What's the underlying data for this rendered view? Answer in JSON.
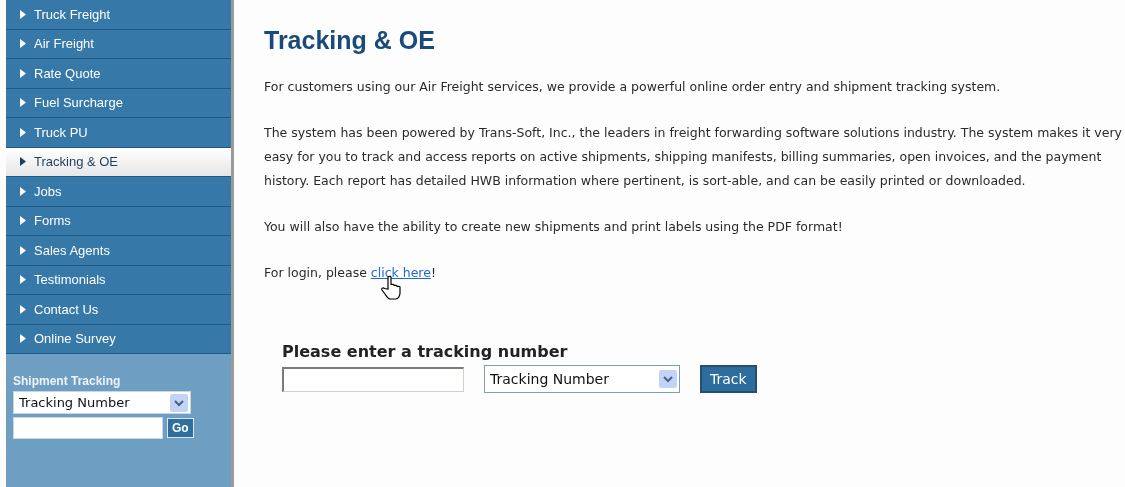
{
  "sidebar": {
    "items": [
      {
        "label": "Truck Freight",
        "selected": false
      },
      {
        "label": "Air Freight",
        "selected": false
      },
      {
        "label": "Rate Quote",
        "selected": false
      },
      {
        "label": "Fuel Surcharge",
        "selected": false
      },
      {
        "label": "Truck PU",
        "selected": false
      },
      {
        "label": "Tracking & OE",
        "selected": true
      },
      {
        "label": "Jobs",
        "selected": false
      },
      {
        "label": "Forms",
        "selected": false
      },
      {
        "label": "Sales Agents",
        "selected": false
      },
      {
        "label": "Testimonials",
        "selected": false
      },
      {
        "label": "Contact Us",
        "selected": false
      },
      {
        "label": "Online Survey",
        "selected": false
      }
    ],
    "tracking": {
      "title": "Shipment Tracking",
      "select_value": "Tracking Number",
      "button": "Go"
    }
  },
  "main": {
    "title": "Tracking & OE",
    "paragraphs": [
      "For customers using our Air Freight services, we provide a powerful online order entry and shipment tracking system.",
      "The system has been powered by Trans-Soft, Inc., the leaders in freight forwarding software solutions industry. The system makes it very easy for you to track and access reports on active shipments, shipping manifests, billing summaries, open invoices, and the payment history. Each report has detailed HWB information where pertinent, is sort-able, and can be easily printed or downloaded.",
      "You will also have the ability to create new shipments and print labels using the PDF format!"
    ],
    "login": {
      "before": "For login, please ",
      "link": "click here",
      "after": "!"
    },
    "form": {
      "title": "Please enter a tracking number",
      "select_value": "Tracking Number",
      "button": "Track"
    }
  }
}
